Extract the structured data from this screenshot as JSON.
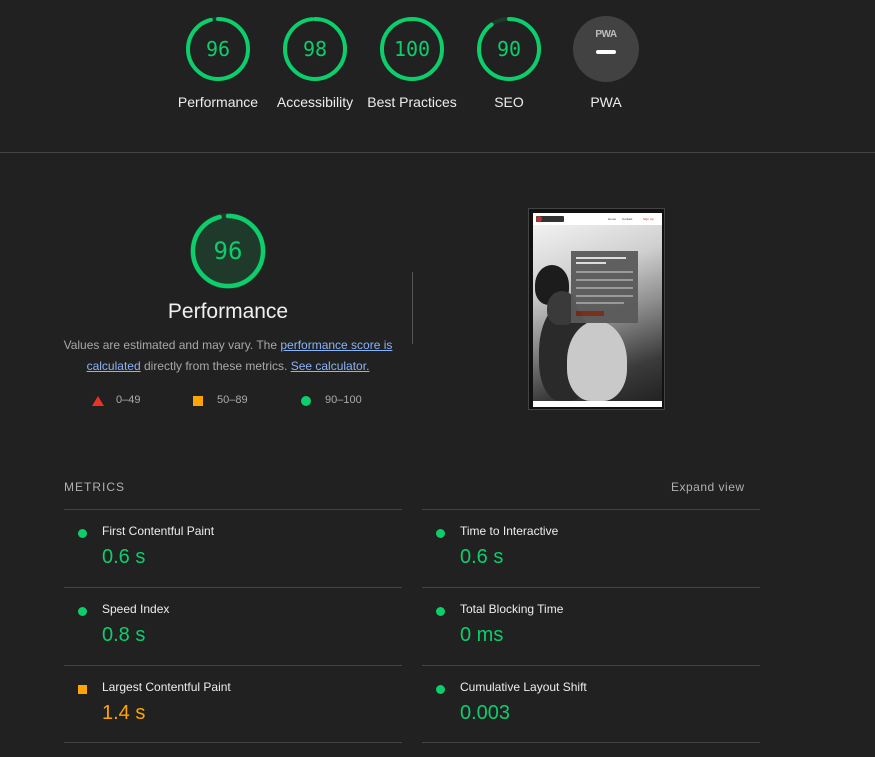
{
  "colors": {
    "pass": "#0cce6b",
    "average": "#ffa400",
    "fail": "#eb3223",
    "background": "#212121"
  },
  "summary_gauges": [
    {
      "id": "performance",
      "score": "96",
      "label": "Performance"
    },
    {
      "id": "accessibility",
      "score": "98",
      "label": "Accessibility"
    },
    {
      "id": "best-practices",
      "score": "100",
      "label": "Best Practices"
    },
    {
      "id": "seo",
      "score": "90",
      "label": "SEO"
    },
    {
      "id": "pwa",
      "badge_text": "PWA",
      "label": "PWA"
    }
  ],
  "performance": {
    "score": "96",
    "title": "Performance",
    "desc_prefix": "Values are estimated and may vary. The ",
    "link_score": "performance score is calculated",
    "desc_middle": " directly from these metrics. ",
    "link_calculator": "See calculator.",
    "legend": [
      {
        "shape": "triangle",
        "range": "0–49"
      },
      {
        "shape": "square",
        "range": "50–89"
      },
      {
        "shape": "circle",
        "range": "90–100"
      }
    ]
  },
  "screenshot_thumbnail": {
    "nav_items": [
      "Home",
      "Contact",
      "Sign Up"
    ]
  },
  "metrics": {
    "header": "METRICS",
    "expand_label": "Expand view",
    "items": [
      {
        "label": "First Contentful Paint",
        "value": "0.6 s",
        "rating": "pass"
      },
      {
        "label": "Time to Interactive",
        "value": "0.6 s",
        "rating": "pass"
      },
      {
        "label": "Speed Index",
        "value": "0.8 s",
        "rating": "pass"
      },
      {
        "label": "Total Blocking Time",
        "value": "0 ms",
        "rating": "pass"
      },
      {
        "label": "Largest Contentful Paint",
        "value": "1.4 s",
        "rating": "average"
      },
      {
        "label": "Cumulative Layout Shift",
        "value": "0.003",
        "rating": "pass"
      }
    ]
  }
}
